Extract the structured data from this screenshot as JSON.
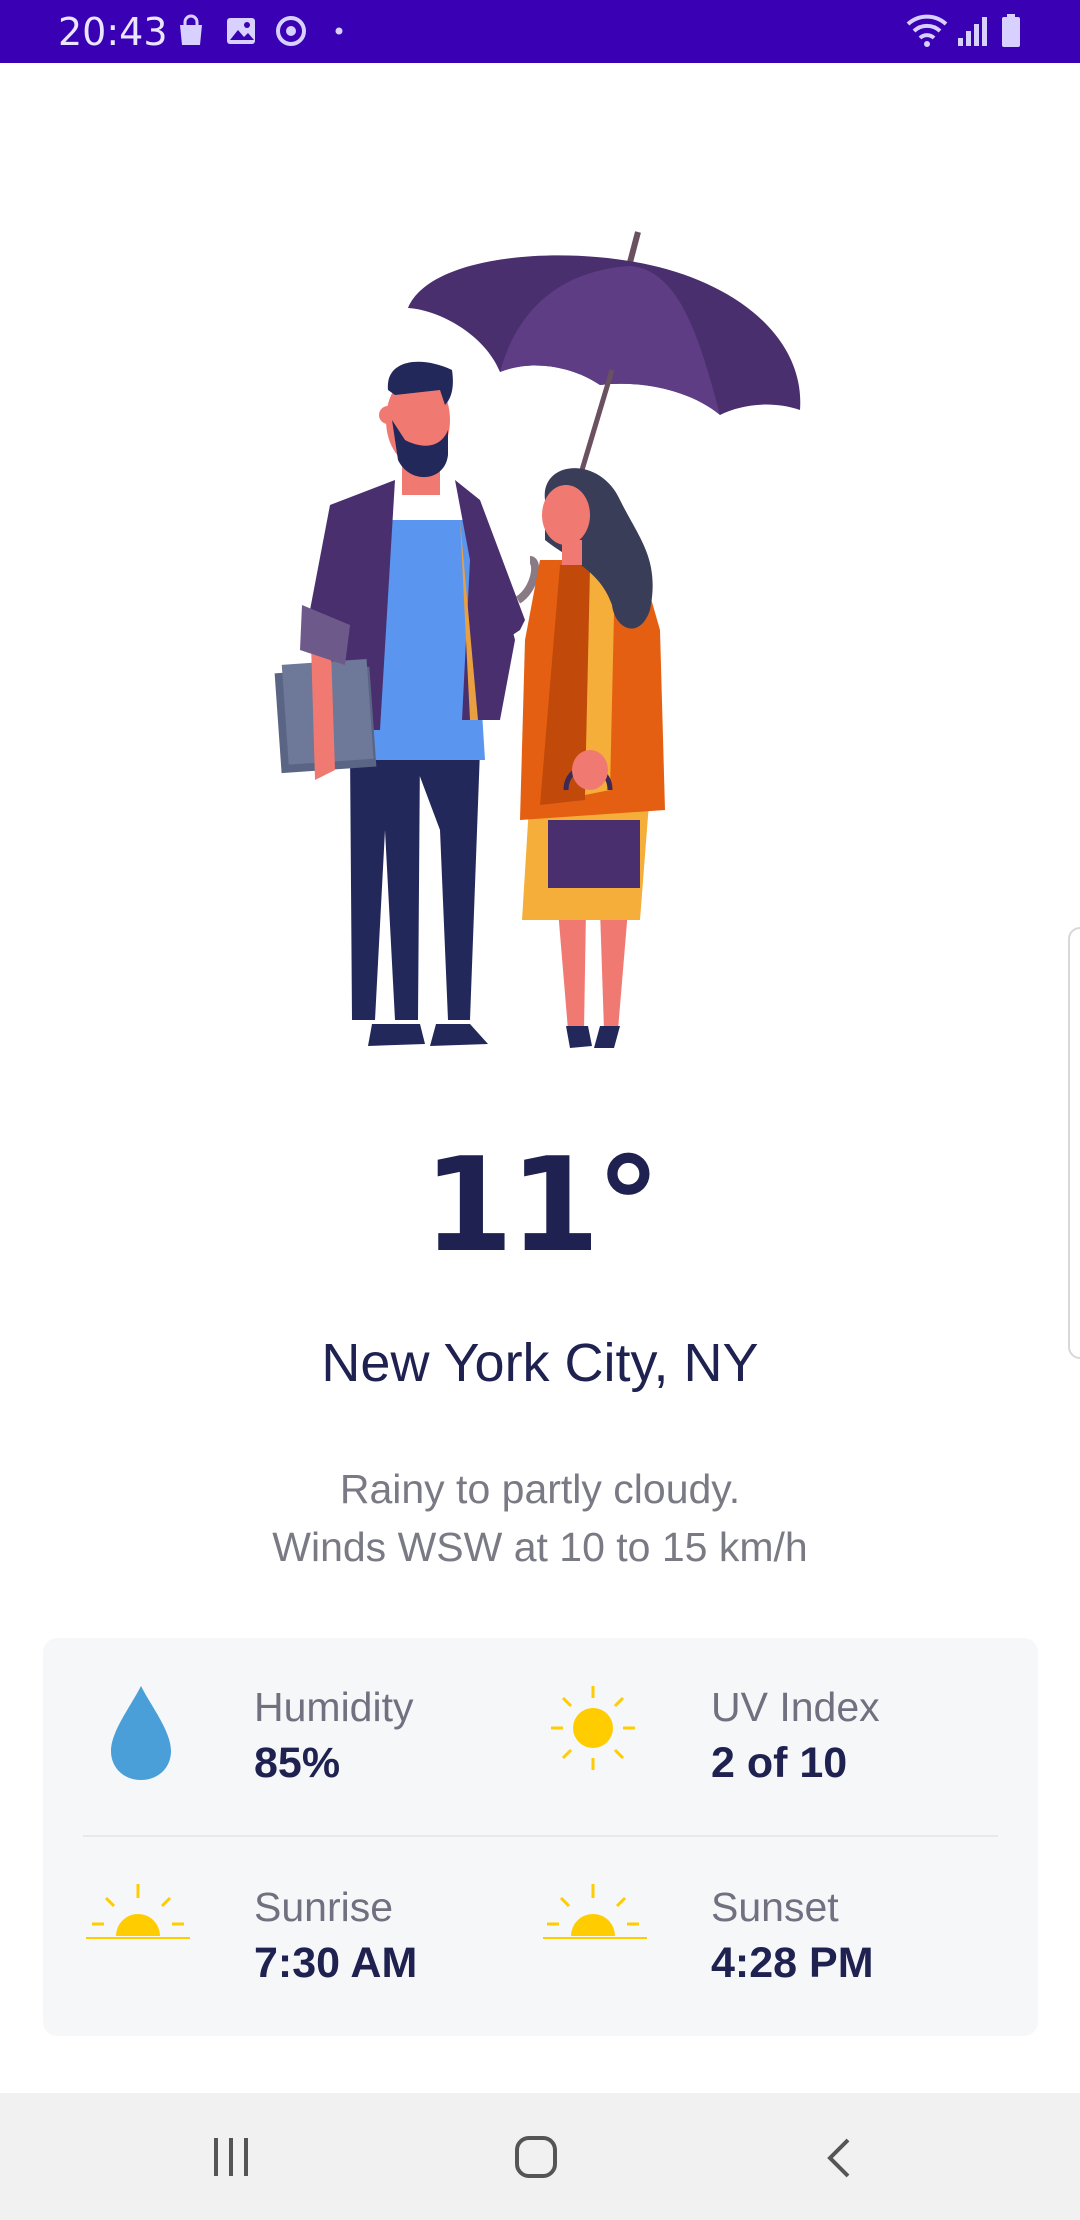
{
  "status_bar": {
    "time": "20:43",
    "left_icons": [
      "shopping-bag-icon",
      "gallery-icon",
      "sync-icon",
      "dot-icon"
    ],
    "right_icons": [
      "wifi-icon",
      "signal-icon",
      "battery-icon"
    ],
    "background": "#3a00b3"
  },
  "weather": {
    "temperature": "11°",
    "location": "New York City, NY",
    "description_lines": [
      "Rainy to partly cloudy.",
      "Winds WSW at 10 to 15 km/h"
    ]
  },
  "stats": [
    {
      "label": "Humidity",
      "value": "85%",
      "icon": "water-drop-icon"
    },
    {
      "label": "UV Index",
      "value": "2 of 10",
      "icon": "sun-icon"
    },
    {
      "label": "Sunrise",
      "value": "7:30 AM",
      "icon": "sunrise-icon"
    },
    {
      "label": "Sunset",
      "value": "4:28 PM",
      "icon": "sunset-icon"
    }
  ],
  "nav_bar": {
    "buttons": [
      "recent-apps-button",
      "home-button",
      "back-button"
    ]
  },
  "colors": {
    "primary_text": "#1f2250",
    "secondary_text": "#7a7a85",
    "sun_yellow": "#ffcc00",
    "drop_blue": "#4a9fd8",
    "card_bg": "#f6f7f9"
  }
}
